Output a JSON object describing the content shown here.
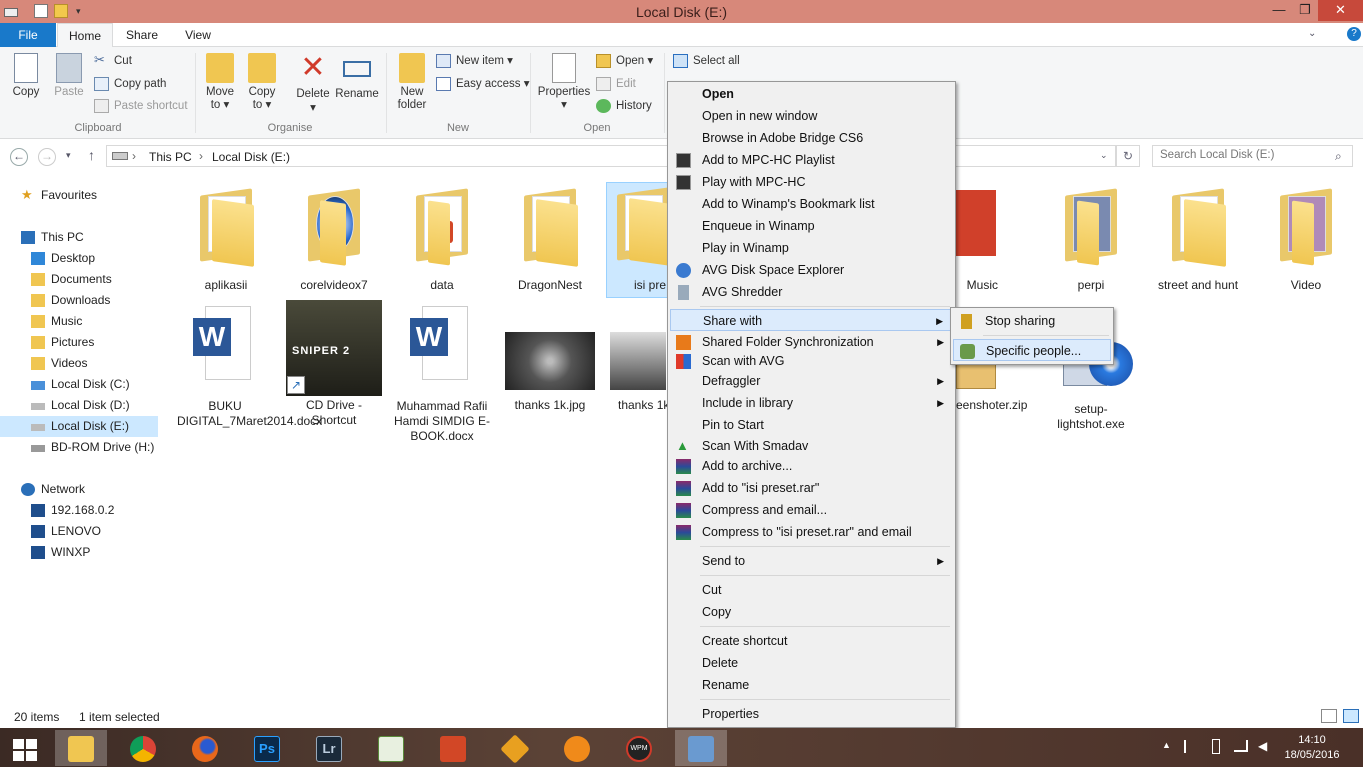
{
  "window": {
    "title": "Local Disk (E:)",
    "min": "—",
    "max": "❐",
    "close": "✕"
  },
  "tabs": {
    "file": "File",
    "home": "Home",
    "share": "Share",
    "view": "View"
  },
  "ribbon": {
    "clipboard": {
      "copy": "Copy",
      "paste": "Paste",
      "cut": "Cut",
      "copy_path": "Copy path",
      "paste_shortcut": "Paste shortcut",
      "label": "Clipboard"
    },
    "organise": {
      "move_to": "Move to ▾",
      "copy_to": "Copy to ▾",
      "delete": "Delete ▾",
      "rename": "Rename",
      "label": "Organise"
    },
    "new": {
      "new_folder": "New folder",
      "new_item": "New item ▾",
      "easy_access": "Easy access ▾",
      "label": "New"
    },
    "open": {
      "properties": "Properties ▾",
      "open": "Open ▾",
      "edit": "Edit",
      "history": "History",
      "label": "Open"
    },
    "select": {
      "select_all": "Select all"
    }
  },
  "address": {
    "this_pc": "This PC",
    "sep": "›",
    "drive": "Local Disk (E:)",
    "search_placeholder": "Search Local Disk (E:)"
  },
  "nav": {
    "favourites": "Favourites",
    "this_pc": "This PC",
    "desktop": "Desktop",
    "documents": "Documents",
    "downloads": "Downloads",
    "music": "Music",
    "pictures": "Pictures",
    "videos": "Videos",
    "disk_c": "Local Disk (C:)",
    "disk_d": "Local Disk (D:)",
    "disk_e": "Local Disk (E:)",
    "bd_rom": "BD-ROM Drive (H:) S",
    "network": "Network",
    "ip": "192.168.0.2",
    "lenovo": "LENOVO",
    "winxp": "WINXP"
  },
  "files": {
    "aplikasii": "aplikasii",
    "corelvideox7": "corelvideox7",
    "data": "data",
    "dragonnest": "DragonNest",
    "isi_preset": "isi pre",
    "music": "Music",
    "perpi": "perpi",
    "street_and_hunt": "street and hunt",
    "video": "Video",
    "buku": "BUKU DIGITAL_7Maret2014.docx",
    "cd_drive": "CD Drive - Shortcut",
    "muhammad": "Muhammad Rafii Hamdi SIMDIG E-BOOK.docx",
    "thanks1": "thanks 1k.jpg",
    "thanks2": "thanks 1k",
    "screenshoter": "eenshoter.zip",
    "lightshot": "setup-lightshot.exe",
    "sniper_text": "SNIPER 2"
  },
  "status": {
    "count": "20 items",
    "selected": "1 item selected"
  },
  "context_menu": {
    "open": "Open",
    "open_new_window": "Open in new window",
    "browse_bridge": "Browse in Adobe Bridge CS6",
    "add_mpc_playlist": "Add to MPC-HC Playlist",
    "play_mpc": "Play with MPC-HC",
    "add_winamp_bookmark": "Add to Winamp's Bookmark list",
    "enqueue_winamp": "Enqueue in Winamp",
    "play_winamp": "Play in Winamp",
    "avg_disk": "AVG Disk Space Explorer",
    "avg_shredder": "AVG Shredder",
    "share_with": "Share with",
    "shared_folder_sync": "Shared Folder Synchronization",
    "scan_avg": "Scan with AVG",
    "defraggler": "Defraggler",
    "include_library": "Include in library",
    "pin_start": "Pin to Start",
    "scan_smadav": "Scan With Smadav",
    "add_archive": "Add to archive...",
    "add_rar": "Add to \"isi preset.rar\"",
    "compress_email": "Compress and email...",
    "compress_rar_email": "Compress to \"isi preset.rar\" and email",
    "send_to": "Send to",
    "cut": "Cut",
    "copy": "Copy",
    "create_shortcut": "Create shortcut",
    "delete": "Delete",
    "rename": "Rename",
    "properties": "Properties",
    "arrow": "▶"
  },
  "submenu": {
    "stop_sharing": "Stop sharing",
    "specific_people": "Specific people..."
  },
  "taskbar": {
    "time": "14:10",
    "date": "18/05/2016",
    "wpm": "WPM",
    "ps": "Ps",
    "lr": "Lr"
  },
  "colors": {
    "titlebar": "#d7887a",
    "close": "#c7493b",
    "file_tab": "#1979ca",
    "selection": "#cce8ff"
  }
}
